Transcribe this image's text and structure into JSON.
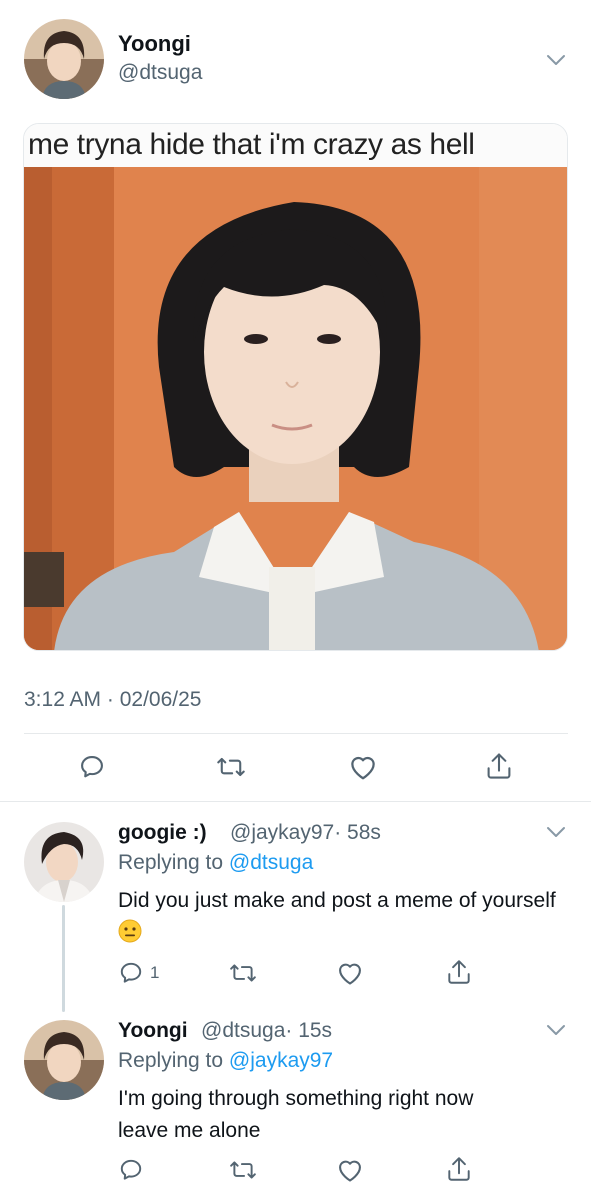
{
  "tweet": {
    "author_name": "Yoongi",
    "author_handle": "@dtsuga",
    "meme_caption": "me tryna hide that i'm crazy as hell",
    "timestamp": "3:12 AM · 02/06/25"
  },
  "replies": [
    {
      "author_name": "googie :)",
      "author_handle": "@jaykay97",
      "time": "· 58s",
      "replying_prefix": "Replying to",
      "replying_to": "@dtsuga",
      "text": "Did you just make and post a meme of yourself",
      "emoji": "neutral-face-emoji",
      "reply_count": "1"
    },
    {
      "author_name": "Yoongi",
      "author_handle": "@dtsuga",
      "time": "· 15s",
      "replying_prefix": "Replying to",
      "replying_to": "@jaykay97",
      "text_line1": "I'm going through something right now",
      "text_line2": "leave me alone"
    }
  ],
  "icons": {
    "reply": "reply-icon",
    "retweet": "retweet-icon",
    "like": "heart-icon",
    "share": "share-icon",
    "more": "chevron-down-icon"
  },
  "colors": {
    "mention": "#1d9bf0",
    "secondary_text": "#536471",
    "primary_text": "#0f1419",
    "meme_background": "#e0834d"
  }
}
